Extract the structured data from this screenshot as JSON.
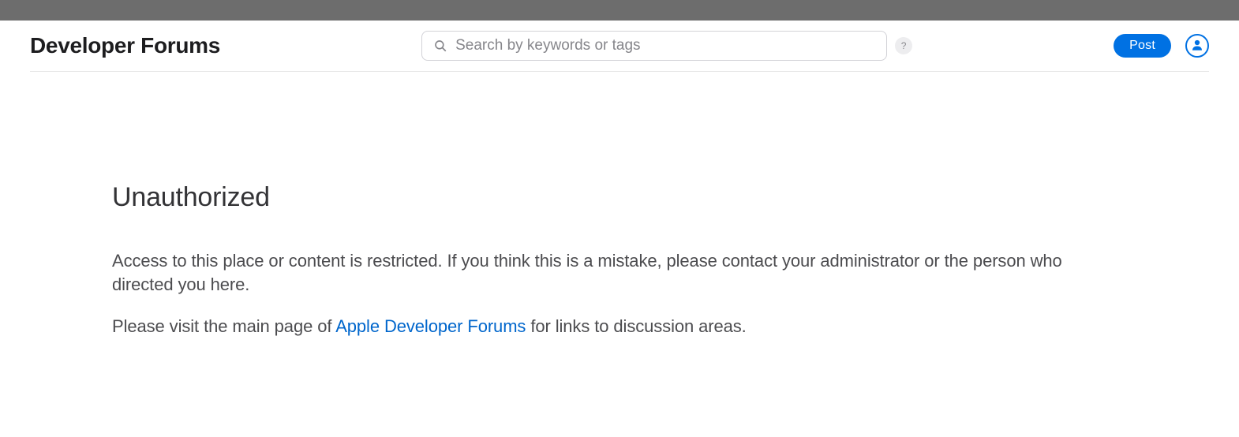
{
  "header": {
    "site_title": "Developer Forums",
    "search_placeholder": "Search by keywords or tags",
    "help_label": "?",
    "post_label": "Post"
  },
  "content": {
    "title": "Unauthorized",
    "paragraph1": "Access to this place or content is restricted. If you think this is a mistake, please contact your administrator or the person who directed you here.",
    "paragraph2_prefix": "Please visit the main page of ",
    "paragraph2_link": "Apple Developer Forums",
    "paragraph2_suffix": " for links to discussion areas."
  },
  "colors": {
    "accent": "#0071e3",
    "link": "#0066cc",
    "text_primary": "#1d1d1f",
    "text_secondary": "#4c4c4f",
    "placeholder": "#86868b",
    "border": "#e5e5e5"
  }
}
